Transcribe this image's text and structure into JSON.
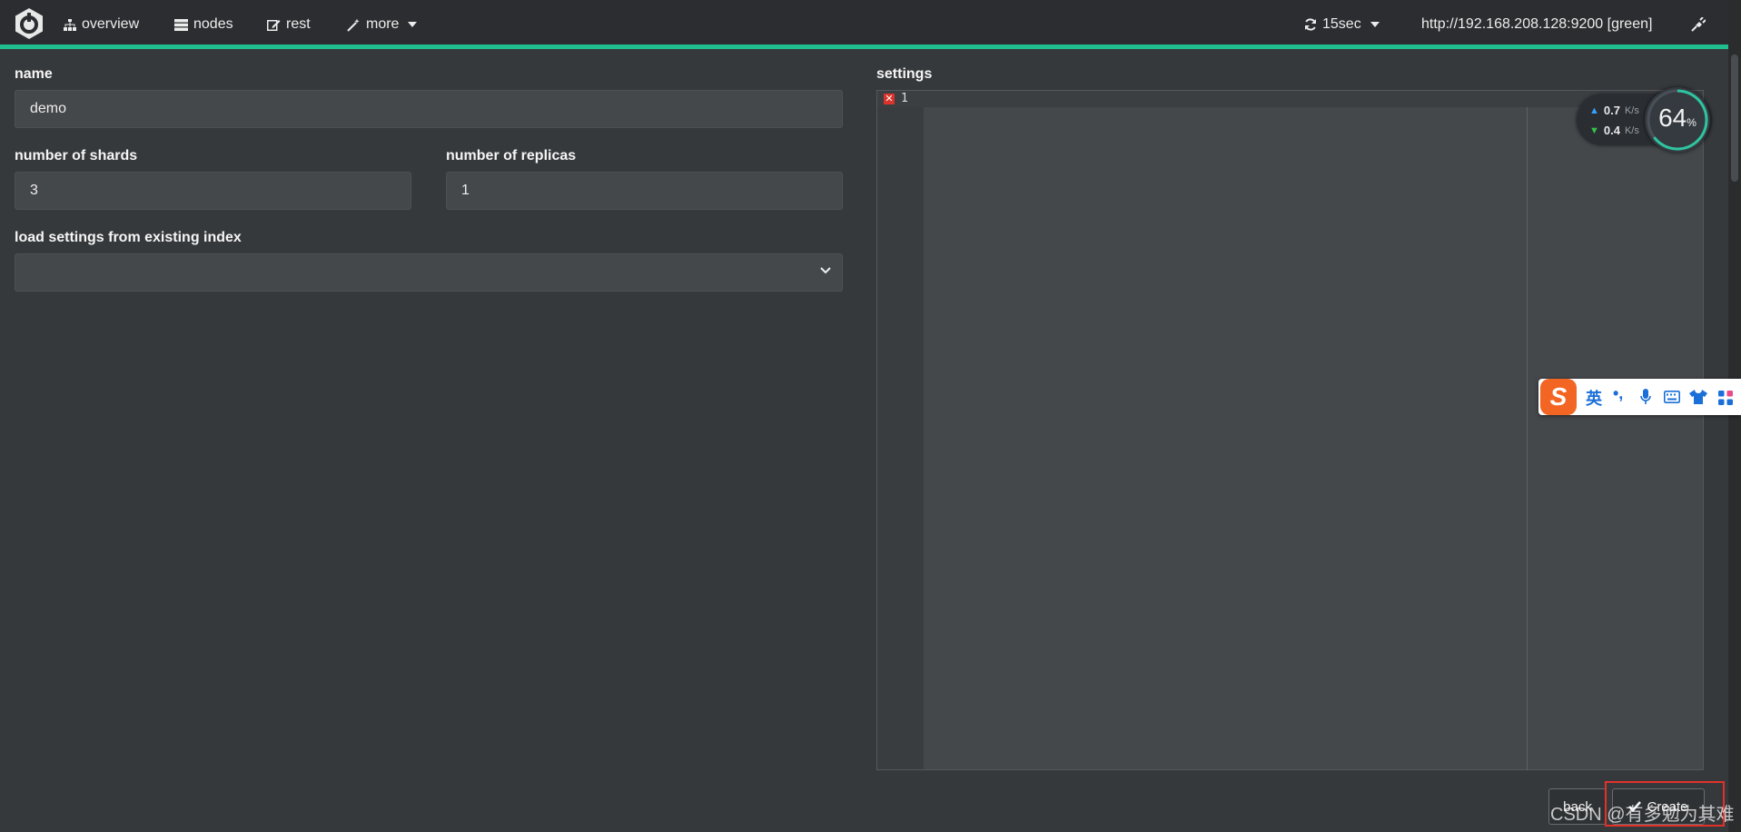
{
  "navbar": {
    "logo_icon": "elasticsearch-head-logo-icon",
    "items": [
      {
        "icon": "sitemap-icon",
        "label": "overview"
      },
      {
        "icon": "server-icon",
        "label": "nodes"
      },
      {
        "icon": "edit-icon",
        "label": "rest"
      },
      {
        "icon": "magic-wand-icon",
        "label": "more"
      }
    ],
    "refresh": {
      "icon": "refresh-icon",
      "label": "15sec"
    },
    "cluster": "http://192.168.208.128:9200 [green]",
    "disconnect_icon": "plug-icon",
    "accent_color": "#1fbf8f"
  },
  "form": {
    "name_label": "name",
    "name_value": "demo",
    "shards_label": "number of shards",
    "shards_value": "3",
    "replicas_label": "number of replicas",
    "replicas_value": "1",
    "load_label": "load settings from existing index",
    "load_value": "",
    "settings_label": "settings"
  },
  "editor": {
    "line_number": "1",
    "error_mark": "✕"
  },
  "buttons": {
    "back": "back",
    "create": "Create"
  },
  "overlay": {
    "net_up_value": "0.7",
    "net_up_unit": "K/s",
    "net_down_value": "0.4",
    "net_down_unit": "K/s",
    "gauge_value": "64",
    "gauge_unit": "%",
    "ime_mode": "英",
    "ime_punct": "•,",
    "watermark": "CSDN @有多勉为其难"
  }
}
